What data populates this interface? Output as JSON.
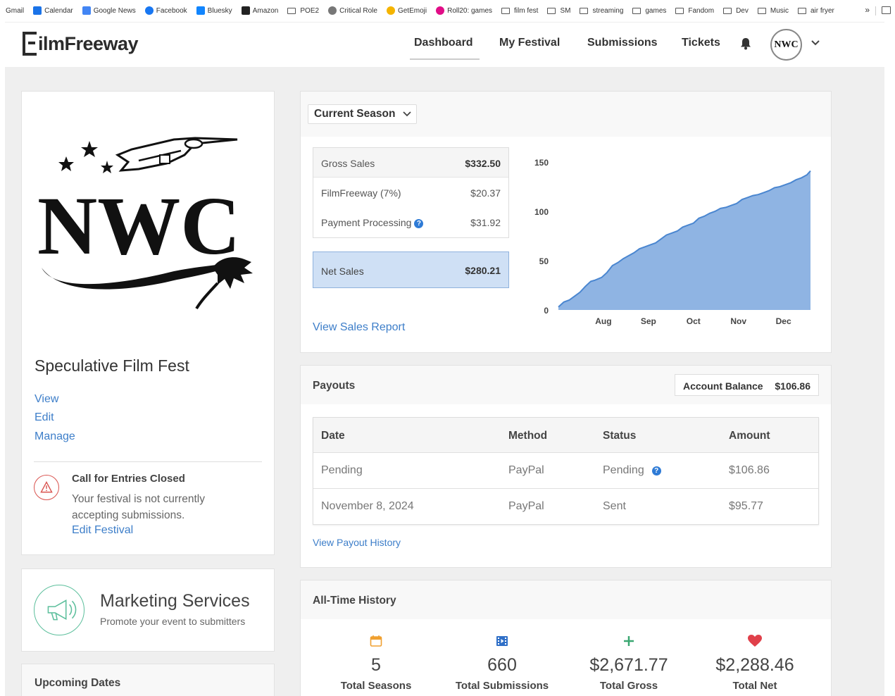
{
  "bookmarks": [
    {
      "label": "Gmail",
      "icon": "gmail-icon",
      "color": ""
    },
    {
      "label": "Calendar",
      "icon": "calendar-icon",
      "color": "#1a73e8"
    },
    {
      "label": "Google News",
      "icon": "news-icon",
      "color": "#4285f4"
    },
    {
      "label": "Facebook",
      "icon": "facebook-icon",
      "color": "#1877f2"
    },
    {
      "label": "Bluesky",
      "icon": "butterfly-icon",
      "color": "#1185fe"
    },
    {
      "label": "Amazon",
      "icon": "amazon-icon",
      "color": "#222222"
    },
    {
      "label": "POE2",
      "icon": "folder-icon",
      "color": ""
    },
    {
      "label": "Critical Role",
      "icon": "critical-role-icon",
      "color": "#777777"
    },
    {
      "label": "GetEmoji",
      "icon": "emoji-icon",
      "color": "#f5b400"
    },
    {
      "label": "Roll20: games",
      "icon": "roll20-icon",
      "color": "#e10d87"
    },
    {
      "label": "film fest",
      "icon": "folder-icon",
      "color": ""
    },
    {
      "label": "SM",
      "icon": "folder-icon",
      "color": ""
    },
    {
      "label": "streaming",
      "icon": "folder-icon",
      "color": ""
    },
    {
      "label": "games",
      "icon": "folder-icon",
      "color": ""
    },
    {
      "label": "Fandom",
      "icon": "folder-icon",
      "color": ""
    },
    {
      "label": "Dev",
      "icon": "folder-icon",
      "color": ""
    },
    {
      "label": "Music",
      "icon": "folder-icon",
      "color": ""
    },
    {
      "label": "air fryer",
      "icon": "folder-icon",
      "color": ""
    }
  ],
  "bookmarks_more": "»",
  "header": {
    "logo_text": "ilmFreeway",
    "nav": {
      "dashboard": "Dashboard",
      "my_festival": "My Festival",
      "submissions": "Submissions",
      "tickets": "Tickets"
    },
    "avatar_text": "NWC"
  },
  "festival": {
    "logo_text": "NWC",
    "name": "Speculative Film Fest",
    "links": {
      "view": "View",
      "edit": "Edit",
      "manage": "Manage"
    },
    "notice": {
      "title": "Call for Entries Closed",
      "text": "Your festival is not currently accepting submissions.",
      "link": "Edit Festival"
    }
  },
  "marketing": {
    "title": "Marketing Services",
    "subtitle": "Promote your event to submitters"
  },
  "upcoming": {
    "title": "Upcoming Dates"
  },
  "sales": {
    "season_select": "Current Season",
    "gross_label": "Gross Sales",
    "gross_value": "$332.50",
    "ff_label": "FilmFreeway (7%)",
    "ff_value": "$20.37",
    "pp_label": "Payment Processing",
    "pp_value": "$31.92",
    "net_label": "Net Sales",
    "net_value": "$280.21",
    "report_link": "View Sales Report"
  },
  "chart_data": {
    "type": "area",
    "title": "",
    "xlabel": "",
    "ylabel": "",
    "x_tick_labels": [
      "Aug",
      "Sep",
      "Oct",
      "Nov",
      "Dec"
    ],
    "y_tick_labels": [
      "0",
      "50",
      "100",
      "150"
    ],
    "ylim": [
      0,
      150
    ],
    "grid": false,
    "color": "#8fb4e3",
    "line_color": "#4a86d0",
    "x": [
      0,
      3,
      6,
      9,
      12,
      15,
      18,
      20,
      24,
      27,
      30,
      33,
      36,
      39,
      42,
      45,
      48,
      51,
      54,
      57,
      60,
      63,
      66,
      69,
      72,
      75,
      78,
      81,
      84,
      87,
      90,
      93,
      96,
      99,
      102,
      105,
      108,
      111,
      114,
      117,
      120,
      123,
      126,
      129,
      132,
      135,
      138,
      140
    ],
    "values": [
      3,
      8,
      10,
      14,
      18,
      24,
      29,
      30,
      33,
      38,
      45,
      48,
      52,
      55,
      58,
      62,
      64,
      66,
      68,
      72,
      76,
      78,
      80,
      84,
      86,
      88,
      93,
      95,
      98,
      100,
      103,
      104,
      106,
      108,
      112,
      114,
      116,
      117,
      119,
      121,
      124,
      125,
      127,
      129,
      132,
      134,
      137,
      141
    ],
    "x_tick_positions": [
      25,
      50,
      75,
      100,
      125
    ]
  },
  "payouts": {
    "title": "Payouts",
    "balance_label": "Account Balance",
    "balance_value": "$106.86",
    "columns": {
      "date": "Date",
      "method": "Method",
      "status": "Status",
      "amount": "Amount"
    },
    "rows": [
      {
        "date": "Pending",
        "method": "PayPal",
        "status": "Pending",
        "amount": "$106.86"
      },
      {
        "date": "November 8, 2024",
        "method": "PayPal",
        "status": "Sent",
        "amount": "$95.77"
      }
    ],
    "history_link": "View Payout History"
  },
  "history": {
    "title": "All-Time History",
    "stats": {
      "seasons": {
        "value": "5",
        "label": "Total Seasons",
        "icon": "calendar-icon",
        "color": "#f0a030"
      },
      "submissions": {
        "value": "660",
        "label": "Total Submissions",
        "icon": "film-icon",
        "color": "#2f6fc7"
      },
      "gross": {
        "value": "$2,671.77",
        "label": "Total Gross",
        "icon": "plus-icon",
        "color": "#3aa771"
      },
      "net": {
        "value": "$2,288.46",
        "label": "Total Net",
        "icon": "heart-icon",
        "color": "#e0404a"
      }
    }
  },
  "colors": {
    "link": "#3d7ec9",
    "net_box": "#cfe0f5",
    "warning": "#d9534f",
    "marketing": "#5cbf9c"
  }
}
